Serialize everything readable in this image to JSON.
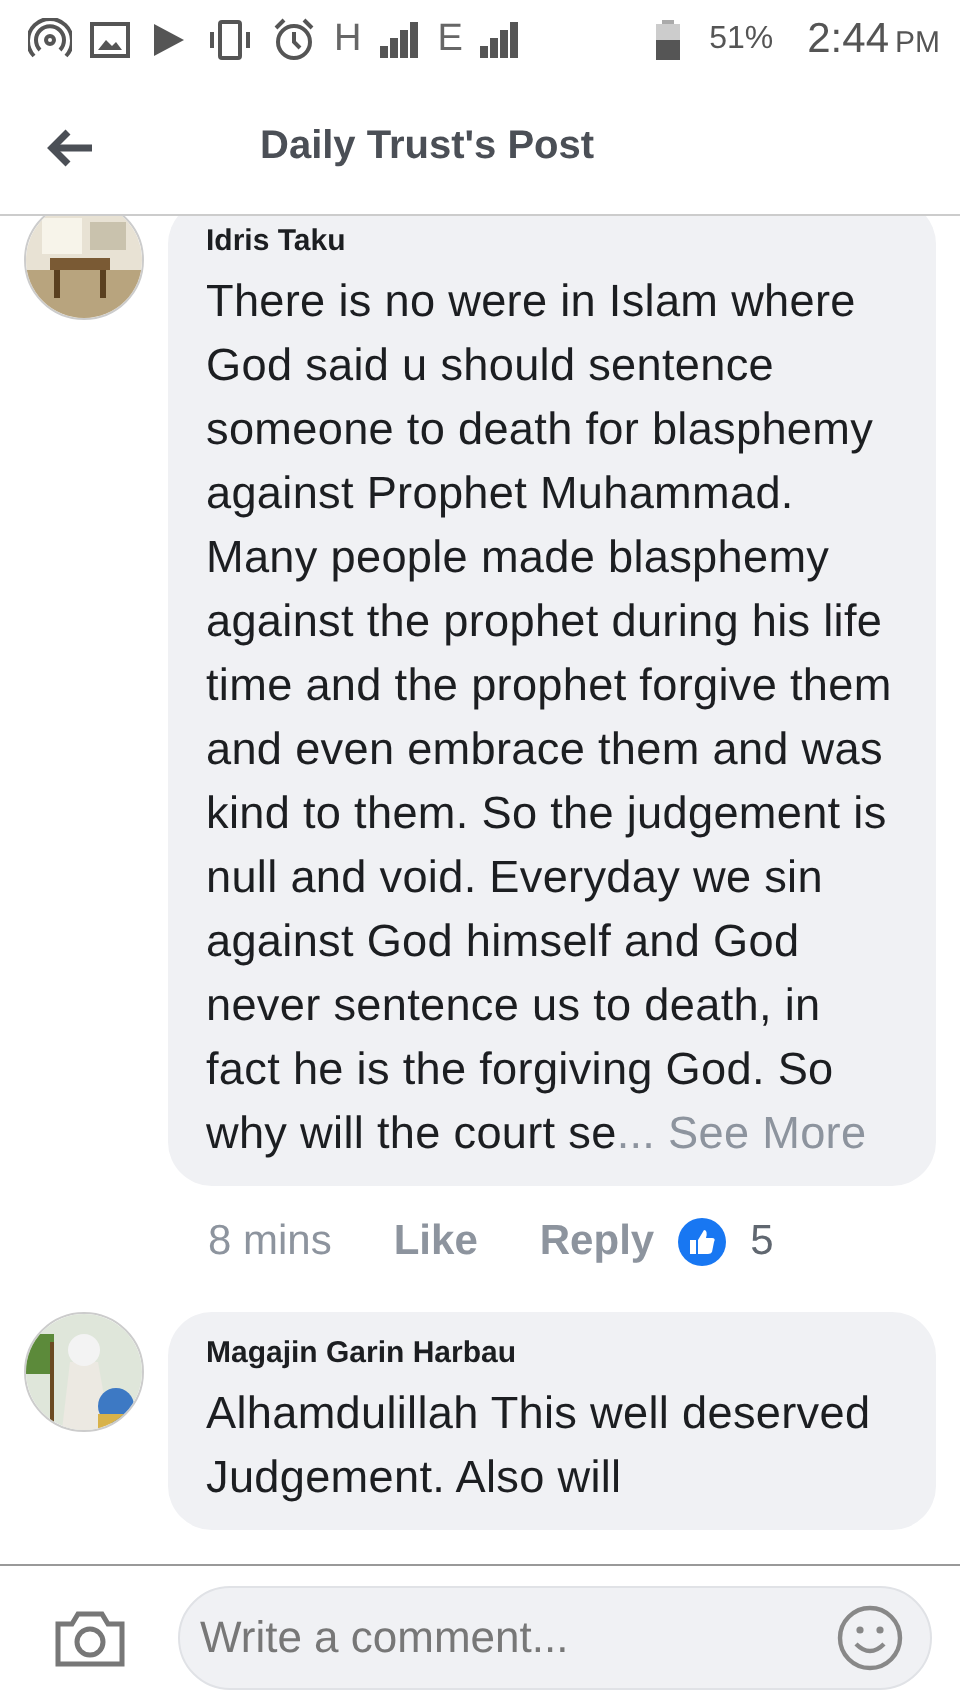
{
  "status_bar": {
    "network_1": "H",
    "network_2": "E",
    "battery": "51%",
    "time": "2:44",
    "ampm": "PM"
  },
  "header": {
    "title": "Daily Trust's Post"
  },
  "comments": [
    {
      "author": "Idris Taku",
      "body": "There is no were in Islam where God said u should sentence someone to death for blasphemy against Prophet Muhammad. Many people made blasphemy against the prophet during his life time and the prophet forgive them and even embrace them and was kind to them. So the judgement is null and void. Everyday we sin against God himself and God never sentence us to death, in fact he is the forgiving God. So why will the court se",
      "see_more": "... See More",
      "time": "8 mins",
      "like": "Like",
      "reply": "Reply",
      "reactions": "5"
    },
    {
      "author": "Magajin Garin Harbau",
      "body": "Alhamdulillah This well deserved Judgement. Also will"
    }
  ],
  "composer": {
    "placeholder": "Write a comment..."
  }
}
